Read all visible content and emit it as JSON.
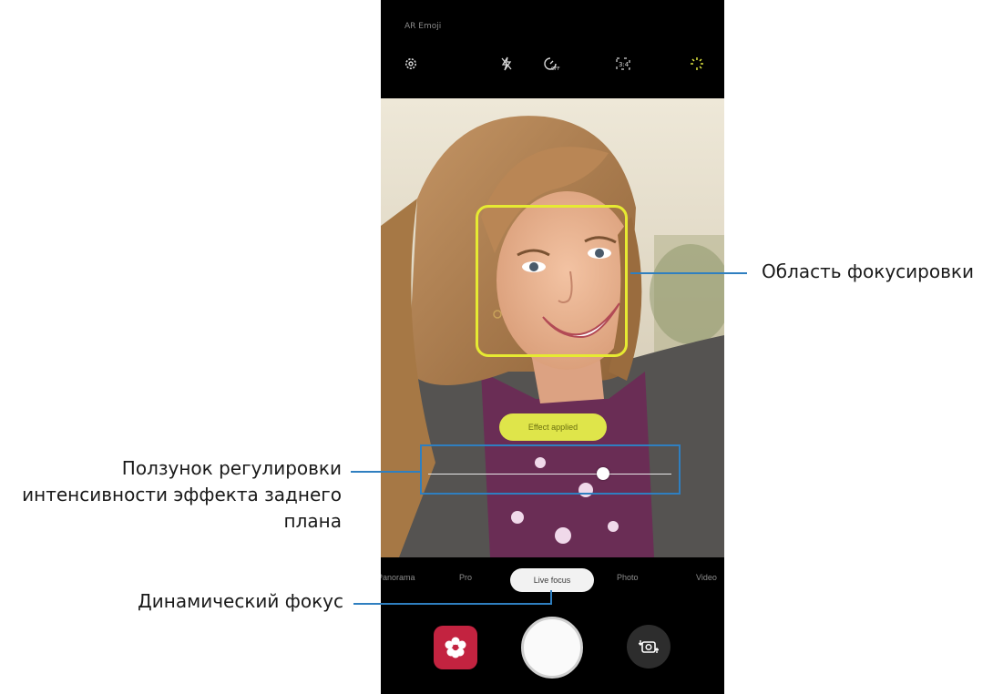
{
  "status_bar": {
    "text": "AR Emoji"
  },
  "top_icons": [
    "settings-icon",
    "flash-off-icon",
    "timer-off-icon",
    "ratio-3-4-icon",
    "filter-effects-icon"
  ],
  "viewfinder": {
    "effect_label": "Effect applied",
    "slider_level_fraction": 0.72
  },
  "modes": {
    "items": [
      "Panorama",
      "Pro",
      "Live focus",
      "Photo",
      "Video"
    ],
    "selected": "Live focus"
  },
  "colors": {
    "focus_frame": "#e6ea32",
    "callout": "#2f7fc0",
    "bixby_button": "#c32340"
  },
  "callouts": {
    "focus_area": "Область фокусировки",
    "slider": [
      "Ползунок регулировки",
      "интенсивности эффекта заднего",
      "плана"
    ],
    "live_focus": "Динамический фокус"
  }
}
